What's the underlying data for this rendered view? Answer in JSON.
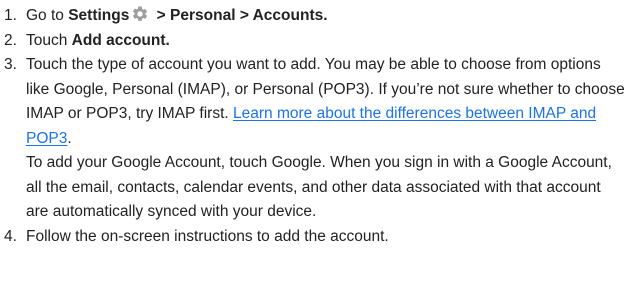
{
  "steps": [
    {
      "number": "1.",
      "prefix": "Go to ",
      "settings": "Settings",
      "path": " > Personal > Accounts.",
      "icon": "gear-icon"
    },
    {
      "number": "2.",
      "prefix": "Touch ",
      "bold": "Add account."
    },
    {
      "number": "3.",
      "text": "Touch the type of account you want to add. You may be able to choose from options like Google, Personal (IMAP), or Personal (POP3). If you’re not sure whether to choose IMAP or POP3, try IMAP first. ",
      "link_text": "Learn more about the differences between IMAP and POP3",
      "link_suffix": ".",
      "extra": "To add your Google Account, touch Google. When you sign in with a Google Account, all the email, contacts, calendar events, and other data associated with that account are automatically synced with your device."
    },
    {
      "number": "4.",
      "text": "Follow the on-screen instructions to add the account."
    }
  ],
  "colors": {
    "text": "#222222",
    "link": "#1a73e8",
    "icon": "#9e9e9e"
  }
}
